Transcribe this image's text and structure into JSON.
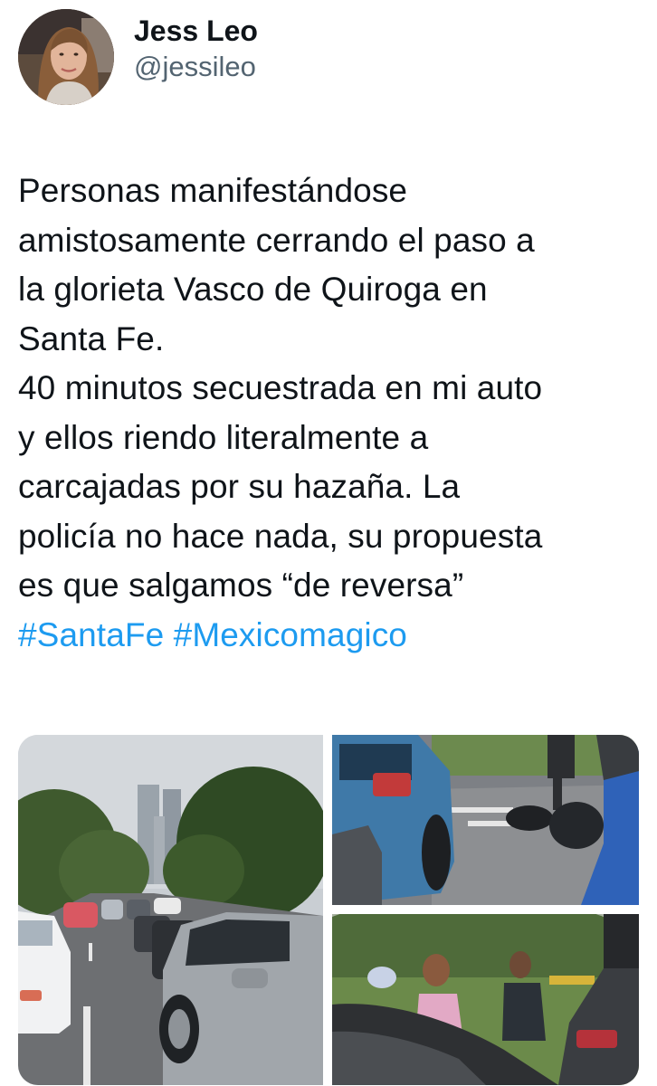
{
  "user": {
    "display_name": "Jess Leo",
    "handle": "@jessileo",
    "avatar_icon": "profile-photo"
  },
  "tweet": {
    "lines": [
      "Personas manifestándose",
      "amistosamente cerrando el paso a",
      "la glorieta Vasco de Quiroga en",
      "Santa Fe.",
      "40 minutos secuestrada en mi auto",
      "y ellos riendo literalmente a",
      "carcajadas por su hazaña. La",
      "policía no hace nada, su propuesta",
      "es que salgamos “de reversa”"
    ],
    "hashtags": [
      "#SantaFe",
      "#Mexicomagico"
    ]
  },
  "media": [
    {
      "name": "traffic-jam-photo"
    },
    {
      "name": "blocked-roundabout-photo"
    },
    {
      "name": "protesters-photo"
    }
  ],
  "colors": {
    "link": "#1d9bf0",
    "text": "#0f1419",
    "secondary": "#536471"
  }
}
